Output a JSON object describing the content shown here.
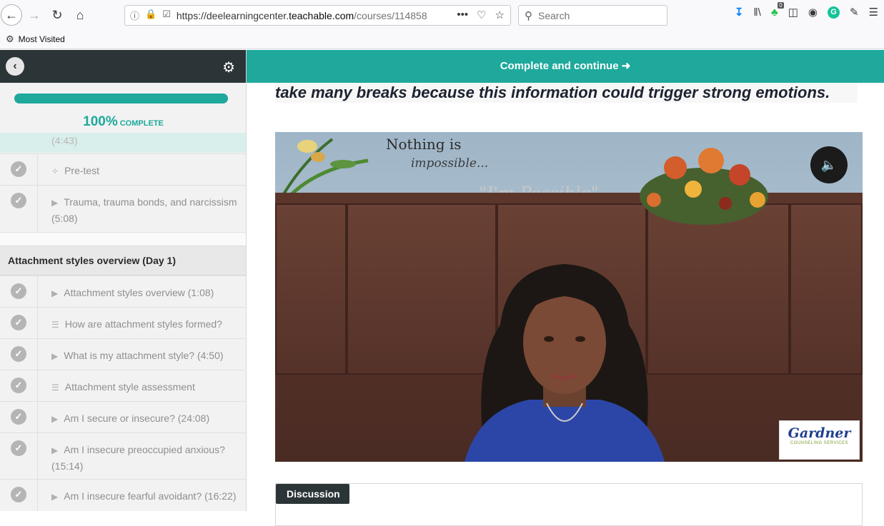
{
  "browser": {
    "url_prefix": "https://deelearningcenter.",
    "url_host": "teachable.com",
    "url_rest": "/courses/114858",
    "search_placeholder": "Search",
    "bookmarks_label": "Most Visited",
    "extension_badge": "0"
  },
  "sidebar": {
    "progress_percent": 100,
    "progress_value": "100%",
    "progress_label": "COMPLETE",
    "ghost_text": "(4:43)",
    "section_title": "Attachment styles overview (Day 1)",
    "lessons_top": [
      {
        "icon": "bulb",
        "label": "Pre-test"
      },
      {
        "icon": "video",
        "label": "Trauma, trauma bonds, and narcissism (5:08)"
      }
    ],
    "lessons": [
      {
        "icon": "video",
        "label": "Attachment styles overview (1:08)"
      },
      {
        "icon": "doc",
        "label": "How are attachment styles formed?"
      },
      {
        "icon": "video",
        "label": "What is my attachment style? (4:50)"
      },
      {
        "icon": "doc",
        "label": "Attachment style assessment"
      },
      {
        "icon": "video",
        "label": "Am I secure or insecure? (24:08)"
      },
      {
        "icon": "video",
        "label": "Am I insecure preoccupied anxious? (15:14)"
      },
      {
        "icon": "video",
        "label": "Am I insecure fearful avoidant? (16:22)"
      }
    ]
  },
  "main": {
    "complete_button": "Complete and continue",
    "banner_text": "take many breaks because this information could trigger strong emotions.",
    "video": {
      "wall_text_1": "Nothing is",
      "wall_text_2": "impossible...",
      "wall_text_3": "\"I'm Possible\"",
      "logo_name": "Gardner",
      "logo_sub": "COUNSELING SERVICES"
    },
    "discussion_tab": "Discussion"
  },
  "colors": {
    "accent": "#1ea99c",
    "dark_header": "#2b3538"
  }
}
